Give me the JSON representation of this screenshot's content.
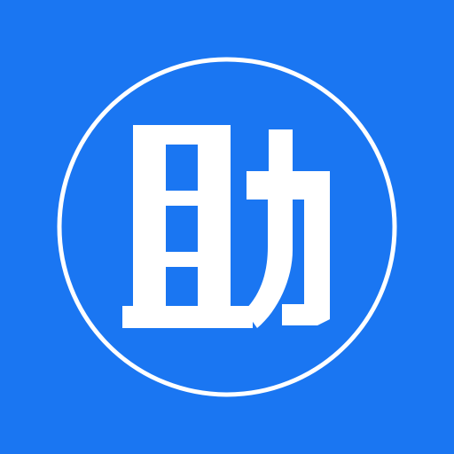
{
  "icon": {
    "glyph": "助",
    "background_color": "#1a76f2",
    "foreground_color": "#ffffff"
  }
}
